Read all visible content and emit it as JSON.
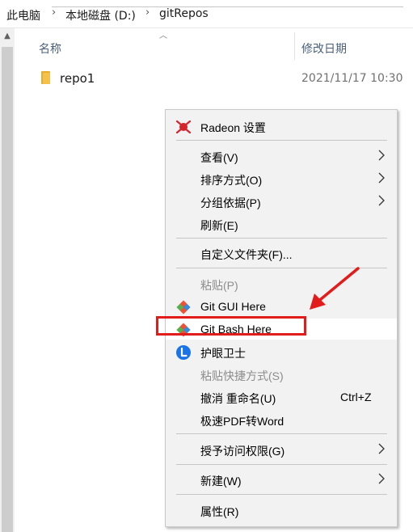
{
  "breadcrumb": {
    "items": [
      "此电脑",
      "本地磁盘 (D:)",
      "gitRepos"
    ],
    "separator": "›"
  },
  "columns": {
    "name": "名称",
    "date": "修改日期"
  },
  "files": [
    {
      "name": "repo1",
      "modified": "2021/11/17 10:30"
    }
  ],
  "context_menu": {
    "radeon": "Radeon 设置",
    "view": "查看(V)",
    "sort": "排序方式(O)",
    "group": "分组依据(P)",
    "refresh": "刷新(E)",
    "customize": "自定义文件夹(F)...",
    "paste": "粘贴(P)",
    "git_gui": "Git GUI Here",
    "git_bash": "Git Bash Here",
    "eye_guard": "护眼卫士",
    "paste_shortcut": "粘贴快捷方式(S)",
    "undo_rename": "撤消 重命名(U)",
    "undo_shortcut": "Ctrl+Z",
    "pdf_word": "极速PDF转Word",
    "grant_access": "授予访问权限(G)",
    "new": "新建(W)",
    "properties": "属性(R)"
  },
  "colors": {
    "highlight": "#e21b1b",
    "folder": "#f4c14a",
    "radeon": "#d4252c",
    "eye_guard": "#1a73e8"
  },
  "icons": [
    "folder-icon",
    "radeon-icon",
    "git-gui-icon",
    "git-bash-icon",
    "eye-guard-icon",
    "submenu-arrow-icon"
  ]
}
